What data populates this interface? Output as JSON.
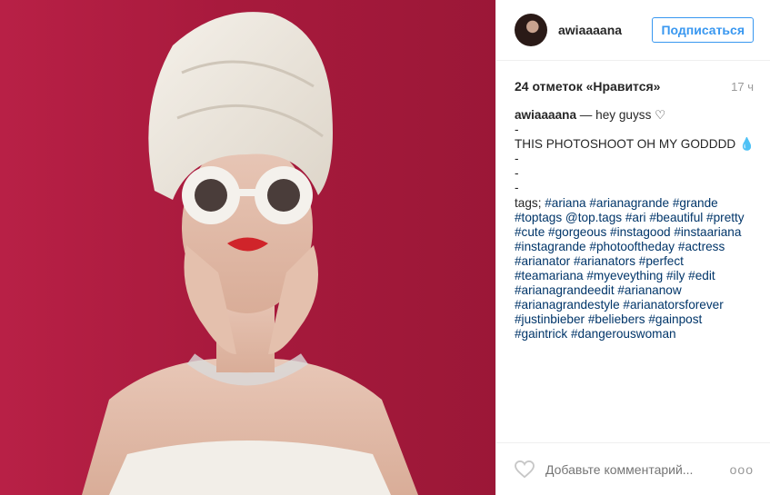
{
  "header": {
    "username": "awiaaaana",
    "follow_label": "Подписаться"
  },
  "meta": {
    "likes": "24 отметок «Нравится»",
    "time": "17 ч"
  },
  "caption": {
    "user": "awiaaaana",
    "first_line": "— hey guyss ♡",
    "lines": [
      "-",
      "THIS PHOTOSHOOT OH MY GODDDD 💧",
      "-",
      "-",
      "-"
    ],
    "tags_prefix": "tags; ",
    "tags": "#ariana #arianagrande #grande #toptags @top.tags #ari #beautiful #pretty #cute #gorgeous #instagood #instaariana #instagrande #photooftheday #actress #arianator #arianators #perfect #teamariana #myeveything #ily #edit #arianagrandeedit #ariananow #arianagrandestyle #arianatorsforever #justinbieber #beliebers #gainpost #gaintrick #dangerouswoman"
  },
  "comment": {
    "placeholder": "Добавьте комментарий...",
    "more_label": "ooo"
  },
  "icons": {
    "like": "heart-outline-icon",
    "more": "ellipsis-icon"
  },
  "colors": {
    "accent": "#3897f0",
    "hashtag": "#003569",
    "photo_background": "#a81a3d"
  }
}
